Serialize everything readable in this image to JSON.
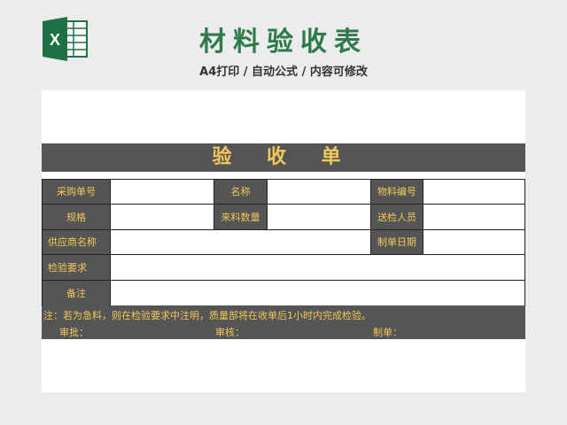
{
  "header": {
    "logo_letter": "X",
    "title": "材料验收表",
    "subtitle": "A4打印 / 自动公式 / 内容可修改"
  },
  "form": {
    "title": "验 收 单",
    "labels": {
      "purchase_no": "采购单号",
      "name": "名称",
      "material_no": "物料编号",
      "spec": "规格",
      "incoming_qty": "来料数量",
      "inspector": "送检人员",
      "supplier": "供应商名称",
      "date": "制单日期",
      "requirements": "检验要求",
      "remarks": "备注"
    },
    "note": "注：若为急料，则在检验要求中注明，质量部将在收单后1小时内完成检验。",
    "approve": "审批：",
    "review": "审核：",
    "maker": "制单："
  },
  "colors": {
    "excel_green": "#1e7145",
    "label_bg": "#555555",
    "label_text": "#f2c85a",
    "title_green": "#2e7a4b"
  }
}
